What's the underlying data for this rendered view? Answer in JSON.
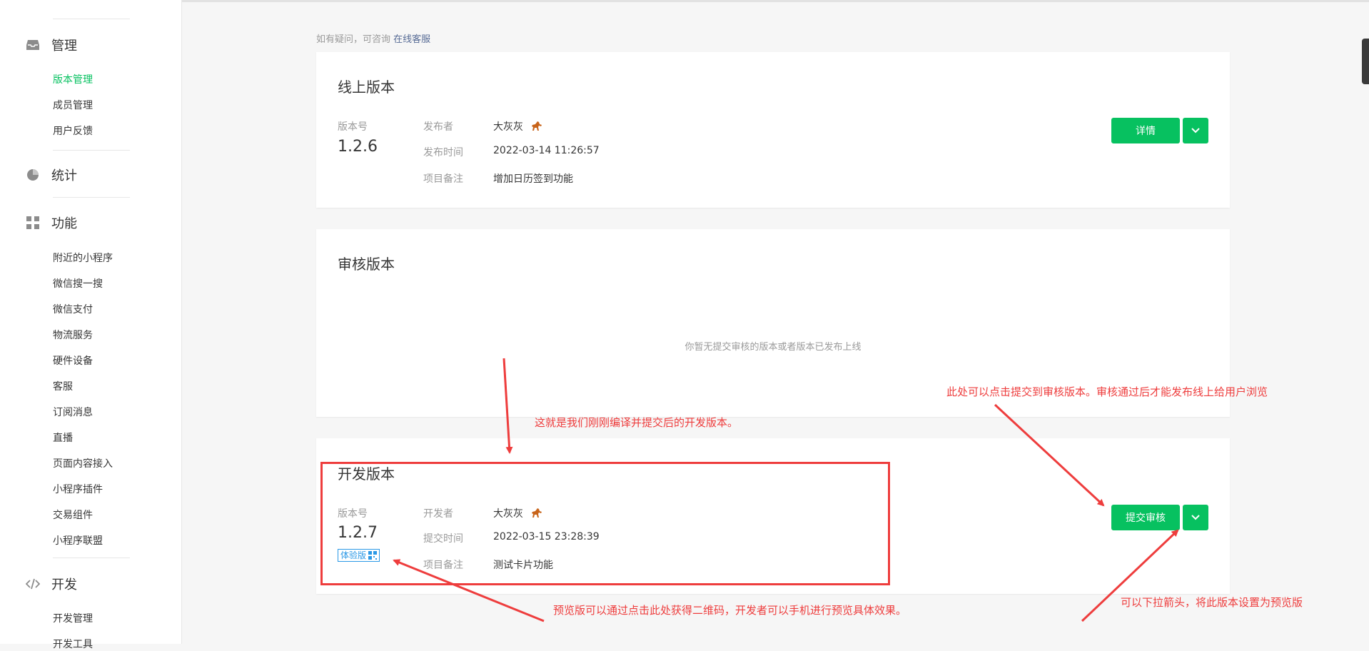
{
  "sidebar": {
    "sections": [
      {
        "label": "管理",
        "icon": "inbox-icon",
        "items": [
          {
            "label": "版本管理",
            "active": true
          },
          {
            "label": "成员管理"
          },
          {
            "label": "用户反馈"
          }
        ]
      },
      {
        "label": "统计",
        "icon": "pie-chart-icon",
        "items": []
      },
      {
        "label": "功能",
        "icon": "grid-icon",
        "items": [
          {
            "label": "附近的小程序"
          },
          {
            "label": "微信搜一搜"
          },
          {
            "label": "微信支付"
          },
          {
            "label": "物流服务"
          },
          {
            "label": "硬件设备"
          },
          {
            "label": "客服"
          },
          {
            "label": "订阅消息"
          },
          {
            "label": "直播"
          },
          {
            "label": "页面内容接入"
          },
          {
            "label": "小程序插件"
          },
          {
            "label": "交易组件"
          },
          {
            "label": "小程序联盟"
          }
        ]
      },
      {
        "label": "开发",
        "icon": "code-icon",
        "items": [
          {
            "label": "开发管理"
          },
          {
            "label": "开发工具"
          }
        ]
      }
    ]
  },
  "hint": {
    "text": "如有疑问，可咨询",
    "link": "在线客服"
  },
  "online": {
    "title": "线上版本",
    "version_label": "版本号",
    "version": "1.2.6",
    "fields": [
      {
        "label": "发布者",
        "value": "大灰灰"
      },
      {
        "label": "发布时间",
        "value": "2022-03-14 11:26:57"
      },
      {
        "label": "项目备注",
        "value": "增加日历签到功能"
      }
    ],
    "button": "详情"
  },
  "review": {
    "title": "审核版本",
    "empty": "你暂无提交审核的版本或者版本已发布上线"
  },
  "dev": {
    "title": "开发版本",
    "version_label": "版本号",
    "version": "1.2.7",
    "tag": "体验版",
    "fields": [
      {
        "label": "开发者",
        "value": "大灰灰"
      },
      {
        "label": "提交时间",
        "value": "2022-03-15 23:28:39"
      },
      {
        "label": "项目备注",
        "value": "测试卡片功能"
      }
    ],
    "button": "提交审核"
  },
  "annotations": {
    "dev_version": "这就是我们刚刚编译并提交后的开发版本。",
    "submit": "此处可以点击提交到审核版本。审核通过后才能发布线上给用户浏览",
    "preview": "预览版可以通过点击此处获得二维码，开发者可以手机进行预览具体效果。",
    "dropdown": "可以下拉箭头，将此版本设置为预览版"
  },
  "colors": {
    "accent": "#07c160",
    "annotation": "#ee3d3d",
    "link": "#576b95",
    "tag": "#2a98e6"
  }
}
